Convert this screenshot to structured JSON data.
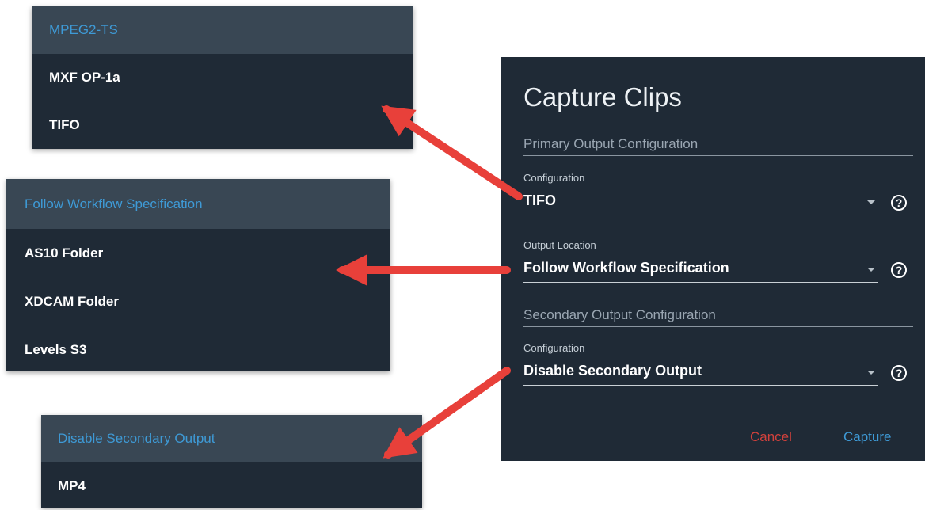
{
  "menus": {
    "primary": [
      "MPEG2-TS",
      "MXF OP-1a",
      "TIFO"
    ],
    "location": [
      "Follow Workflow Specification",
      "AS10 Folder",
      "XDCAM Folder",
      "Levels S3"
    ],
    "secondary": [
      "Disable Secondary Output",
      "MP4"
    ]
  },
  "dialog": {
    "title": "Capture Clips",
    "primary_section": "Primary Output Configuration",
    "config_label": "Configuration",
    "config_value": "TIFO",
    "location_label": "Output Location",
    "location_value": "Follow Workflow Specification",
    "secondary_section": "Secondary Output Configuration",
    "secondary_label": "Configuration",
    "secondary_value": "Disable Secondary Output",
    "help_glyph": "?",
    "cancel_label": "Cancel",
    "capture_label": "Capture"
  },
  "colors": {
    "panel_bg": "#1f2a36",
    "selected_bg": "#394754",
    "accent_blue": "#3e9ad6",
    "cancel_red": "#d2413c",
    "arrow_red": "#e8403a"
  }
}
